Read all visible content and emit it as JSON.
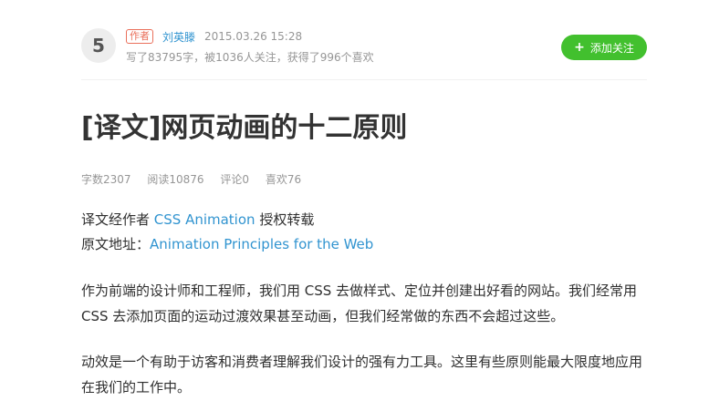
{
  "author": {
    "avatar_glyph": "5",
    "badge": "作者",
    "name": "刘英滕",
    "time": "2015.03.26 15:28",
    "stats": "写了83795字，被1036人关注，获得了996个喜欢",
    "follow_icon": "+",
    "follow_label": "添加关注"
  },
  "article": {
    "title": "[译文]网页动画的十二原则",
    "meta": {
      "words": "字数2307",
      "reads": "阅读10876",
      "comments": "评论0",
      "likes": "喜欢76"
    },
    "source": {
      "line1_prefix": "译文经作者 ",
      "line1_link": "CSS Animation",
      "line1_suffix": " 授权转载",
      "line2_prefix": "原文地址：",
      "line2_link": "Animation Principles for the Web"
    },
    "paragraphs": [
      "作为前端的设计师和工程师，我们用 CSS 去做样式、定位并创建出好看的网站。我们经常用 CSS 去添加页面的运动过渡效果甚至动画，但我们经常做的东西不会超过这些。",
      "动效是一个有助于访客和消费者理解我们设计的强有力工具。这里有些原则能最大限度地应用在我们的工作中。"
    ]
  },
  "colors": {
    "accent_blue": "#3194d0",
    "follow_green": "#42c02e",
    "badge_red": "#ea6f5a",
    "meta_gray": "#969696"
  }
}
